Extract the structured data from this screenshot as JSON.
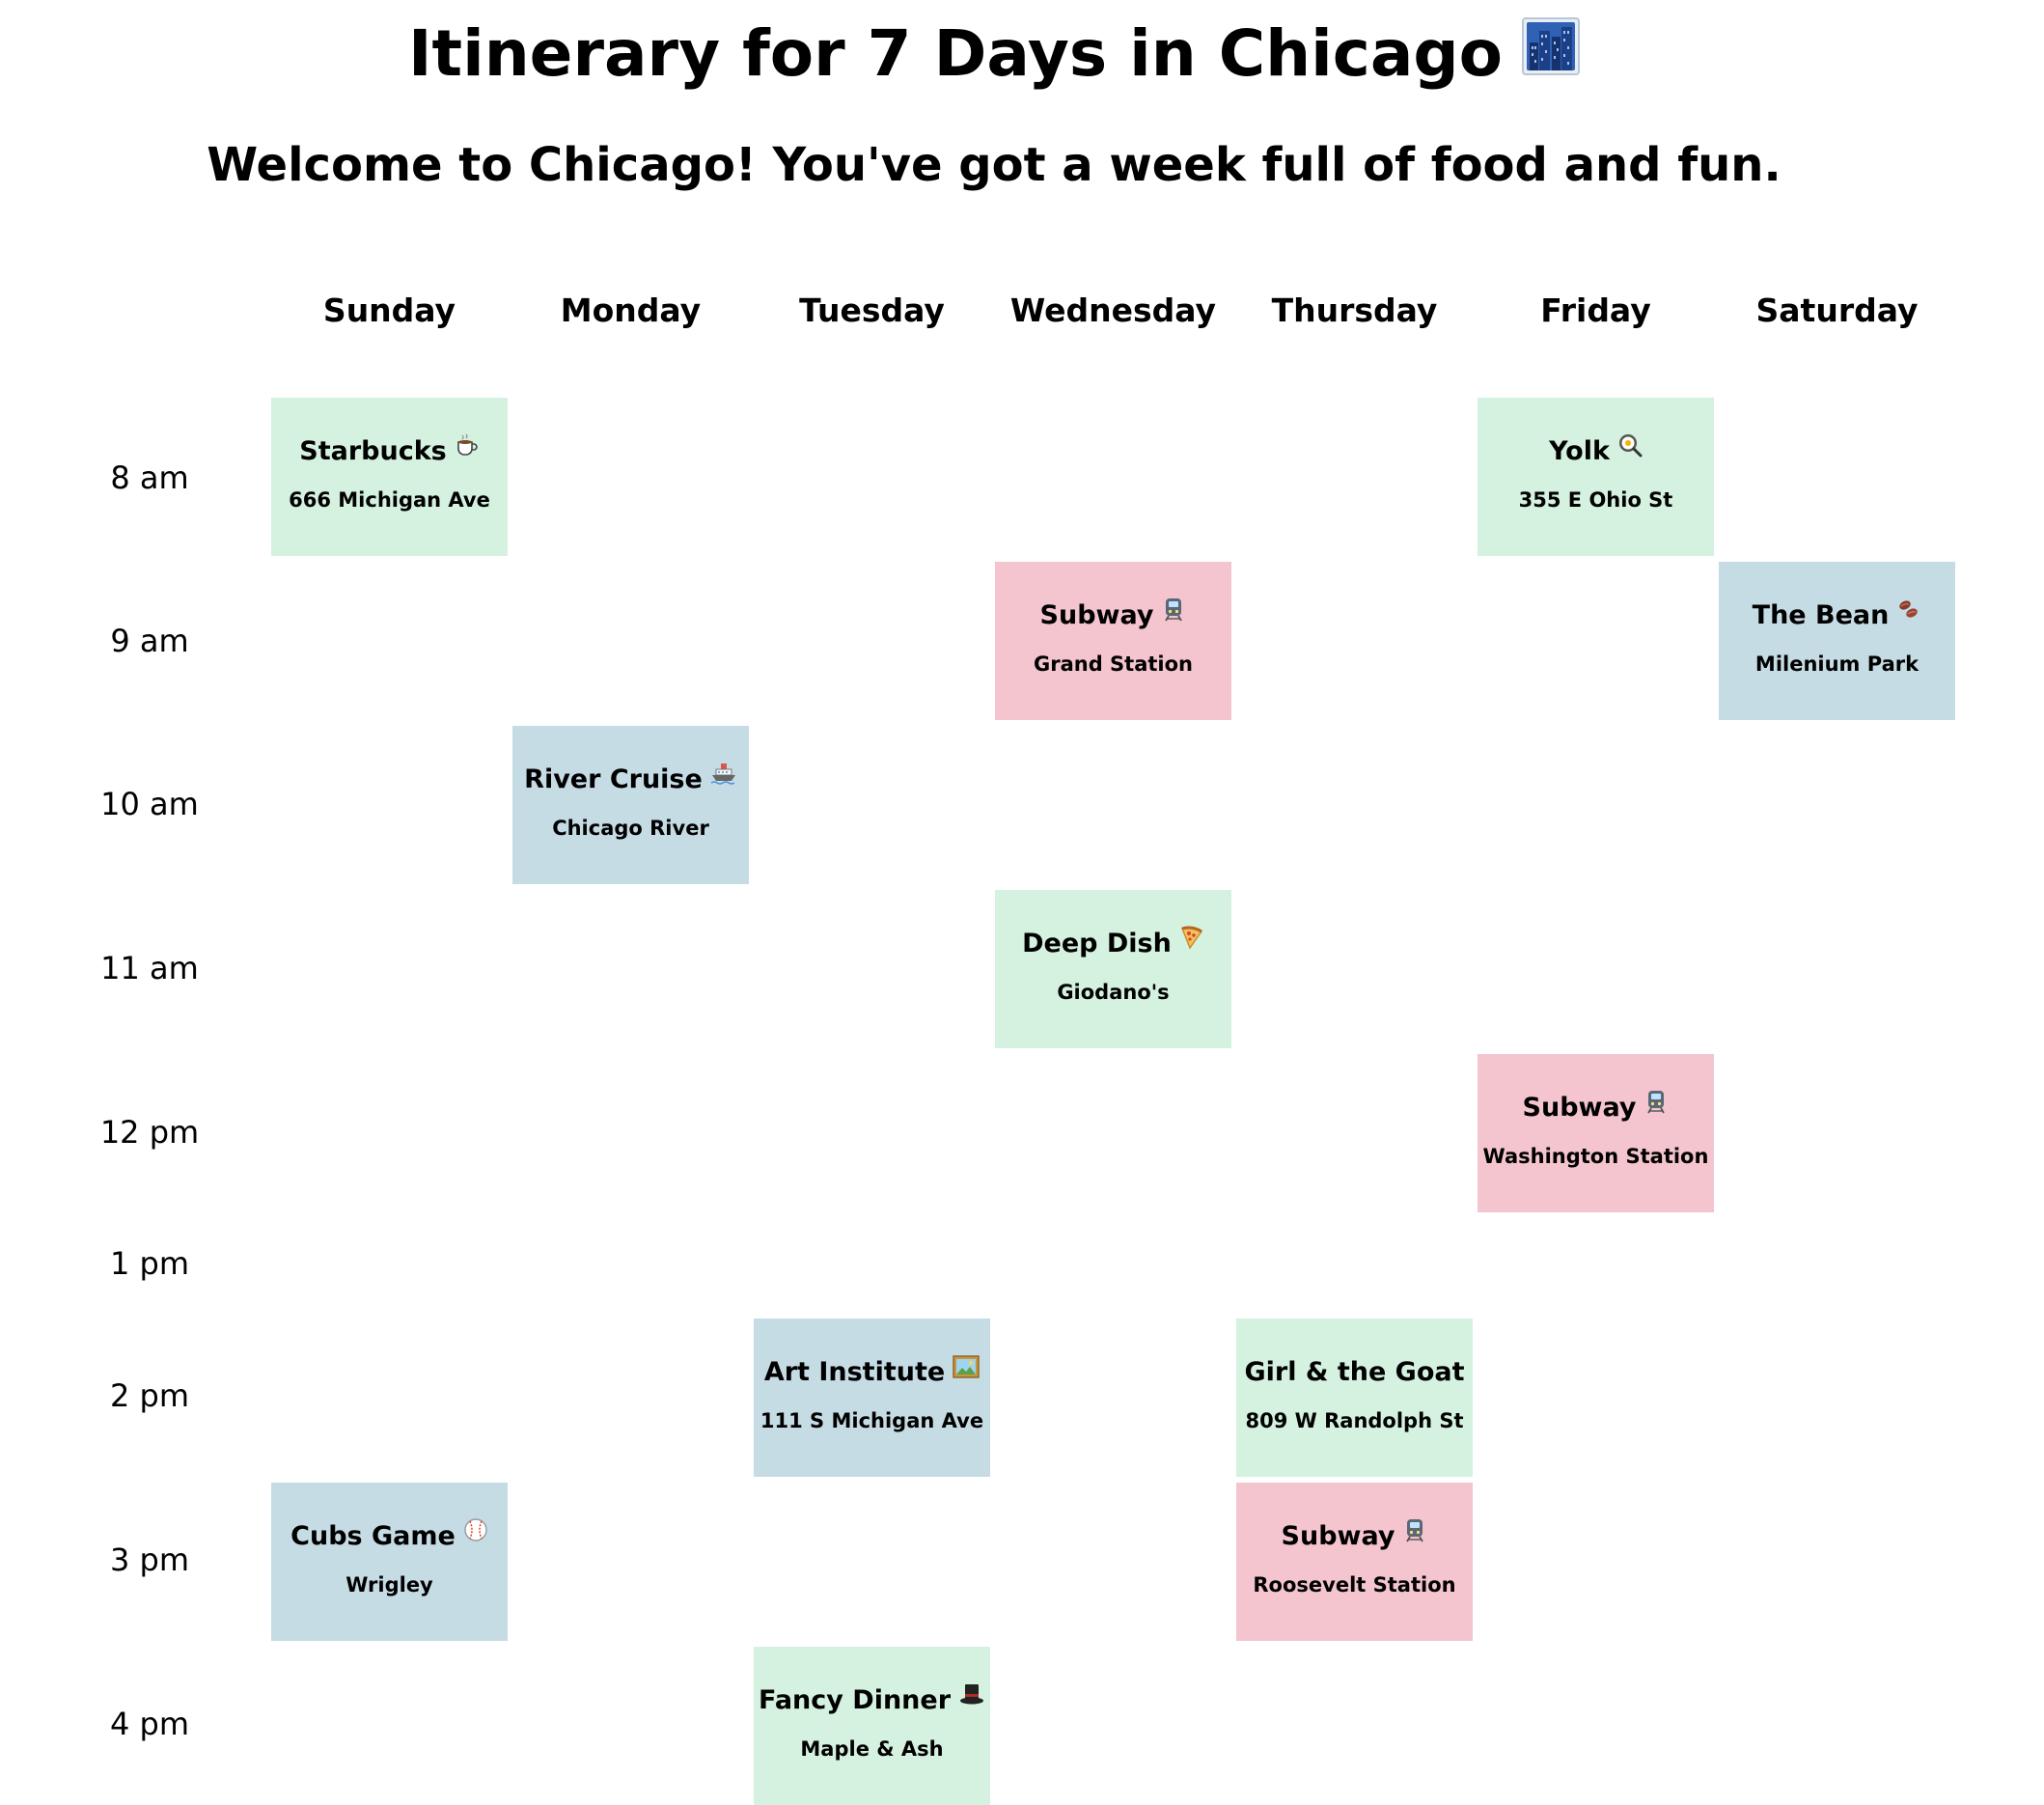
{
  "page": {
    "title": "Itinerary for 7 Days in Chicago",
    "title_icon": "cityscape-icon",
    "subtitle": "Welcome to Chicago! You've got a week full of food and fun."
  },
  "colors": {
    "green": "#d4f2df",
    "blue": "#c6dce5",
    "pink": "#f4c5cf"
  },
  "days": [
    "Sunday",
    "Monday",
    "Tuesday",
    "Wednesday",
    "Thursday",
    "Friday",
    "Saturday"
  ],
  "times": [
    "8 am",
    "9 am",
    "10 am",
    "11 am",
    "12 pm",
    "1 pm",
    "2 pm",
    "3 pm",
    "4 pm"
  ],
  "events": [
    {
      "day": "Sunday",
      "time": "8 am",
      "title": "Starbucks",
      "place": "666 Michigan Ave",
      "icon": "coffee-icon",
      "color": "green"
    },
    {
      "day": "Friday",
      "time": "8 am",
      "title": "Yolk",
      "place": "355 E Ohio St",
      "icon": "frying-pan-icon",
      "color": "green"
    },
    {
      "day": "Wednesday",
      "time": "9 am",
      "title": "Subway",
      "place": "Grand Station",
      "icon": "train-icon",
      "color": "pink"
    },
    {
      "day": "Saturday",
      "time": "9 am",
      "title": "The Bean",
      "place": "Milenium Park",
      "icon": "beans-icon",
      "color": "blue"
    },
    {
      "day": "Monday",
      "time": "10 am",
      "title": "River Cruise",
      "place": "Chicago River",
      "icon": "ship-icon",
      "color": "blue"
    },
    {
      "day": "Wednesday",
      "time": "11 am",
      "title": "Deep Dish",
      "place": "Giodano's",
      "icon": "pizza-icon",
      "color": "green"
    },
    {
      "day": "Friday",
      "time": "12 pm",
      "title": "Subway",
      "place": "Washington Station",
      "icon": "train-icon",
      "color": "pink"
    },
    {
      "day": "Tuesday",
      "time": "2 pm",
      "title": "Art Institute",
      "place": "111 S Michigan Ave",
      "icon": "framed-picture-icon",
      "color": "blue"
    },
    {
      "day": "Thursday",
      "time": "2 pm",
      "title": "Girl & the Goat",
      "place": "809 W Randolph St",
      "icon": "",
      "color": "green"
    },
    {
      "day": "Sunday",
      "time": "3 pm",
      "title": "Cubs Game",
      "place": "Wrigley",
      "icon": "baseball-icon",
      "color": "blue"
    },
    {
      "day": "Thursday",
      "time": "3 pm",
      "title": "Subway",
      "place": "Roosevelt Station",
      "icon": "train-icon",
      "color": "pink"
    },
    {
      "day": "Tuesday",
      "time": "4 pm",
      "title": "Fancy Dinner",
      "place": "Maple & Ash",
      "icon": "top-hat-icon",
      "color": "green"
    }
  ]
}
